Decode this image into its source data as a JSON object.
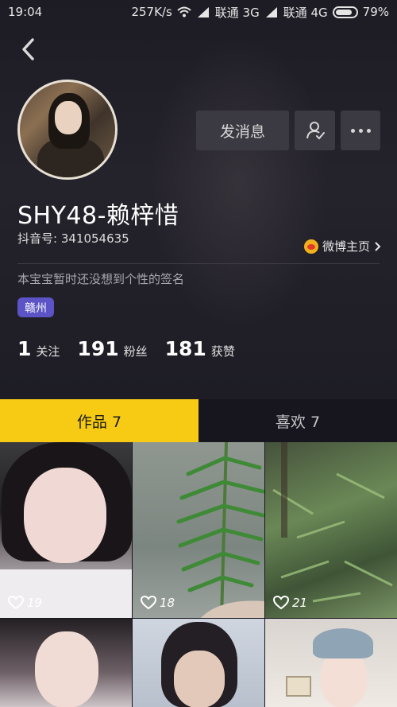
{
  "status_bar": {
    "time": "19:04",
    "speed": "257K/s",
    "carrier1": "联通 3G",
    "carrier2": "联通 4G",
    "battery": "79%"
  },
  "profile": {
    "username": "SHY48-赖梓惜",
    "douyin_id": "抖音号: 341054635",
    "weibo_link": "微博主页",
    "signature": "本宝宝暂时还没想到个性的签名",
    "location": "赣州",
    "buttons": {
      "message": "发消息"
    },
    "stats": [
      {
        "value": "1",
        "label": "关注"
      },
      {
        "value": "191",
        "label": "粉丝"
      },
      {
        "value": "181",
        "label": "获赞"
      }
    ]
  },
  "tabs": [
    {
      "label": "作品 7",
      "active": true
    },
    {
      "label": "喜欢 7",
      "active": false
    }
  ],
  "videos": [
    {
      "likes": "19"
    },
    {
      "likes": "18"
    },
    {
      "likes": "21"
    }
  ],
  "colors": {
    "accent_yellow": "#f7cb14",
    "location_tag": "#5b53c6",
    "background": "#17161f"
  }
}
